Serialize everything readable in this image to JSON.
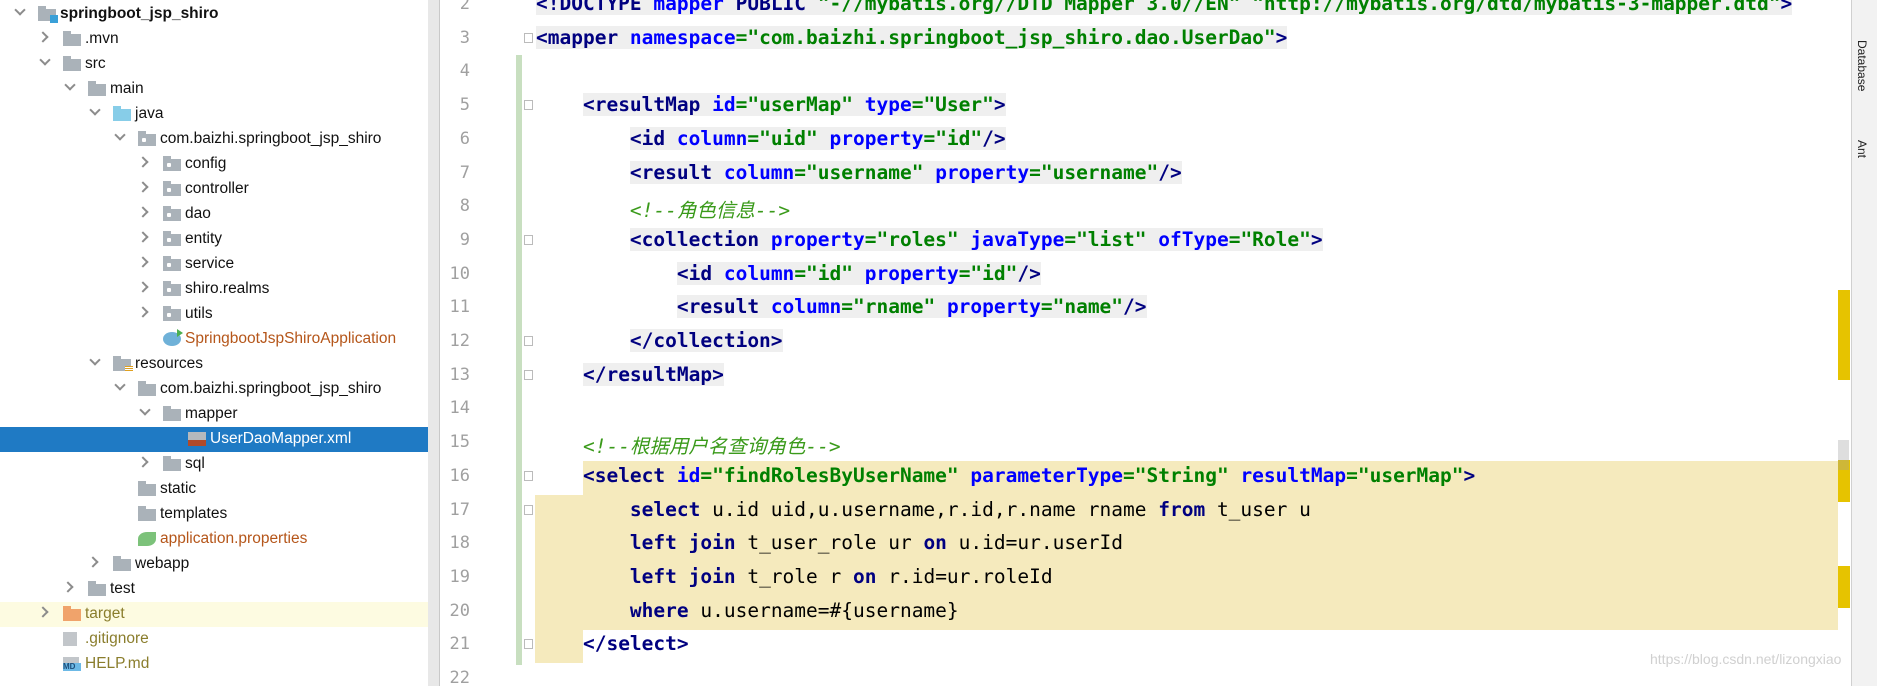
{
  "project_tree": {
    "selected": "UserDaoMapper.xml",
    "items": [
      {
        "label": "springboot_jsp_shiro",
        "level": 0,
        "arrow": "down",
        "icon": "mod",
        "bold": true
      },
      {
        "label": ".mvn",
        "level": 1,
        "arrow": "right",
        "icon": "folder"
      },
      {
        "label": "src",
        "level": 1,
        "arrow": "down",
        "icon": "folder"
      },
      {
        "label": "main",
        "level": 2,
        "arrow": "down",
        "icon": "folder"
      },
      {
        "label": "java",
        "level": 3,
        "arrow": "down",
        "icon": "src"
      },
      {
        "label": "com.baizhi.springboot_jsp_shiro",
        "level": 4,
        "arrow": "down",
        "icon": "pkg"
      },
      {
        "label": "config",
        "level": 5,
        "arrow": "right",
        "icon": "pkg"
      },
      {
        "label": "controller",
        "level": 5,
        "arrow": "right",
        "icon": "pkg"
      },
      {
        "label": "dao",
        "level": 5,
        "arrow": "right",
        "icon": "pkg"
      },
      {
        "label": "entity",
        "level": 5,
        "arrow": "right",
        "icon": "pkg"
      },
      {
        "label": "service",
        "level": 5,
        "arrow": "right",
        "icon": "pkg"
      },
      {
        "label": "shiro.realms",
        "level": 5,
        "arrow": "right",
        "icon": "pkg"
      },
      {
        "label": "utils",
        "level": 5,
        "arrow": "right",
        "icon": "pkg"
      },
      {
        "label": "SpringbootJspShiroApplication",
        "level": 5,
        "arrow": "",
        "icon": "spring",
        "color": "#b5561a"
      },
      {
        "label": "resources",
        "level": 3,
        "arrow": "down",
        "icon": "res"
      },
      {
        "label": "com.baizhi.springboot_jsp_shiro",
        "level": 4,
        "arrow": "down",
        "icon": "folder"
      },
      {
        "label": "mapper",
        "level": 5,
        "arrow": "down",
        "icon": "folder"
      },
      {
        "label": "UserDaoMapper.xml",
        "level": 6,
        "arrow": "",
        "icon": "xml",
        "selected": true
      },
      {
        "label": "sql",
        "level": 5,
        "arrow": "right",
        "icon": "folder"
      },
      {
        "label": "static",
        "level": 4,
        "arrow": "",
        "icon": "folder"
      },
      {
        "label": "templates",
        "level": 4,
        "arrow": "",
        "icon": "folder"
      },
      {
        "label": "application.properties",
        "level": 4,
        "arrow": "",
        "icon": "props",
        "color": "#b5561a"
      },
      {
        "label": "webapp",
        "level": 3,
        "arrow": "right",
        "icon": "folder"
      },
      {
        "label": "test",
        "level": 2,
        "arrow": "right",
        "icon": "folder"
      },
      {
        "label": "target",
        "level": 1,
        "arrow": "right",
        "icon": "excl",
        "color": "#8a7d2c",
        "highlight": true
      },
      {
        "label": ".gitignore",
        "level": 1,
        "arrow": "",
        "icon": "file",
        "color": "#8a7d2c"
      },
      {
        "label": "HELP.md",
        "level": 1,
        "arrow": "",
        "icon": "md",
        "color": "#8a7d2c"
      }
    ]
  },
  "editor": {
    "lines": [
      {
        "n": "2",
        "indent": "",
        "tokens": [
          {
            "t": "<!DOCTYPE ",
            "c": "tag"
          },
          {
            "t": "mapper ",
            "c": "attr"
          },
          {
            "t": "PUBLIC ",
            "c": "tag"
          },
          {
            "t": "\"-//mybatis.org//DTD Mapper 3.0//EN\" ",
            "c": "val"
          },
          {
            "t": "\"http://mybatis.org/dtd/mybatis-3-mapper.dtd\"",
            "c": "val"
          },
          {
            "t": ">",
            "c": "tag"
          }
        ],
        "bg": true
      },
      {
        "n": "3",
        "indent": "",
        "tokens": [
          {
            "t": "<mapper ",
            "c": "tag"
          },
          {
            "t": "namespace",
            "c": "attr"
          },
          {
            "t": "=\"com.baizhi.springboot_jsp_shiro.dao.UserDao\"",
            "c": "val"
          },
          {
            "t": ">",
            "c": "tag"
          }
        ],
        "bg": true,
        "fold": true
      },
      {
        "n": "4",
        "indent": "",
        "tokens": []
      },
      {
        "n": "5",
        "indent": "    ",
        "tokens": [
          {
            "t": "<resultMap ",
            "c": "tag"
          },
          {
            "t": "id",
            "c": "attr"
          },
          {
            "t": "=\"userMap\" ",
            "c": "val"
          },
          {
            "t": "type",
            "c": "attr"
          },
          {
            "t": "=\"User\"",
            "c": "val"
          },
          {
            "t": ">",
            "c": "tag"
          }
        ],
        "bg": true,
        "fold": true
      },
      {
        "n": "6",
        "indent": "        ",
        "tokens": [
          {
            "t": "<id ",
            "c": "tag"
          },
          {
            "t": "column",
            "c": "attr"
          },
          {
            "t": "=\"uid\" ",
            "c": "val"
          },
          {
            "t": "property",
            "c": "attr"
          },
          {
            "t": "=\"id\"",
            "c": "val"
          },
          {
            "t": "/>",
            "c": "tag"
          }
        ],
        "bg": true
      },
      {
        "n": "7",
        "indent": "        ",
        "tokens": [
          {
            "t": "<result ",
            "c": "tag"
          },
          {
            "t": "column",
            "c": "attr"
          },
          {
            "t": "=\"username\" ",
            "c": "val"
          },
          {
            "t": "property",
            "c": "attr"
          },
          {
            "t": "=\"username\"",
            "c": "val"
          },
          {
            "t": "/>",
            "c": "tag"
          }
        ],
        "bg": true
      },
      {
        "n": "8",
        "indent": "        ",
        "tokens": [
          {
            "t": "<!--角色信息-->",
            "c": "cmt"
          }
        ]
      },
      {
        "n": "9",
        "indent": "        ",
        "tokens": [
          {
            "t": "<collection ",
            "c": "tag"
          },
          {
            "t": "property",
            "c": "attr"
          },
          {
            "t": "=\"roles\" ",
            "c": "val"
          },
          {
            "t": "javaType",
            "c": "attr"
          },
          {
            "t": "=\"list\" ",
            "c": "val"
          },
          {
            "t": "ofType",
            "c": "attr"
          },
          {
            "t": "=\"Role\"",
            "c": "val"
          },
          {
            "t": ">",
            "c": "tag"
          }
        ],
        "bg": true,
        "fold": true
      },
      {
        "n": "10",
        "indent": "            ",
        "tokens": [
          {
            "t": "<id ",
            "c": "tag"
          },
          {
            "t": "column",
            "c": "attr"
          },
          {
            "t": "=\"id\" ",
            "c": "val"
          },
          {
            "t": "property",
            "c": "attr"
          },
          {
            "t": "=\"id\"",
            "c": "val"
          },
          {
            "t": "/>",
            "c": "tag"
          }
        ],
        "bg": true
      },
      {
        "n": "11",
        "indent": "            ",
        "tokens": [
          {
            "t": "<result ",
            "c": "tag"
          },
          {
            "t": "column",
            "c": "attr"
          },
          {
            "t": "=\"rname\" ",
            "c": "val"
          },
          {
            "t": "property",
            "c": "attr"
          },
          {
            "t": "=\"name\"",
            "c": "val"
          },
          {
            "t": "/>",
            "c": "tag"
          }
        ],
        "bg": true
      },
      {
        "n": "12",
        "indent": "        ",
        "tokens": [
          {
            "t": "</collection>",
            "c": "tag"
          }
        ],
        "bg": true,
        "fold": true
      },
      {
        "n": "13",
        "indent": "    ",
        "tokens": [
          {
            "t": "</resultMap>",
            "c": "tag"
          }
        ],
        "bg": true,
        "fold": true
      },
      {
        "n": "14",
        "indent": "",
        "tokens": []
      },
      {
        "n": "15",
        "indent": "    ",
        "tokens": [
          {
            "t": "<!--根据用户名查询角色-->",
            "c": "cmt"
          }
        ]
      },
      {
        "n": "16",
        "indent": "    ",
        "tokens": [
          {
            "t": "<select ",
            "c": "tag"
          },
          {
            "t": "id",
            "c": "attr"
          },
          {
            "t": "=\"findRolesByUserName\" ",
            "c": "val"
          },
          {
            "t": "parameterType",
            "c": "attr"
          },
          {
            "t": "=\"String\" ",
            "c": "val"
          },
          {
            "t": "resultMap",
            "c": "attr"
          },
          {
            "t": "=\"userMap\"",
            "c": "val"
          },
          {
            "t": ">",
            "c": "tag"
          }
        ],
        "fold": true
      },
      {
        "n": "17",
        "indent": "        ",
        "tokens": [
          {
            "t": "select ",
            "c": "kw"
          },
          {
            "t": "u.id uid,u.username,r.id,r.name rname ",
            "c": "txt"
          },
          {
            "t": "from ",
            "c": "kw"
          },
          {
            "t": "t_user u",
            "c": "txt"
          }
        ],
        "fold": true
      },
      {
        "n": "18",
        "indent": "        ",
        "tokens": [
          {
            "t": "left join ",
            "c": "kw"
          },
          {
            "t": "t_user_role ur ",
            "c": "txt"
          },
          {
            "t": "on ",
            "c": "kw"
          },
          {
            "t": "u.id=ur.userId",
            "c": "txt"
          }
        ]
      },
      {
        "n": "19",
        "indent": "        ",
        "tokens": [
          {
            "t": "left join ",
            "c": "kw"
          },
          {
            "t": "t_role r ",
            "c": "txt"
          },
          {
            "t": "on ",
            "c": "kw"
          },
          {
            "t": "r.id=ur.roleId",
            "c": "txt"
          }
        ]
      },
      {
        "n": "20",
        "indent": "        ",
        "tokens": [
          {
            "t": "where ",
            "c": "kw"
          },
          {
            "t": "u.username=#{username}",
            "c": "txt"
          }
        ]
      },
      {
        "n": "21",
        "indent": "    ",
        "tokens": [
          {
            "t": "</select>",
            "c": "tag"
          }
        ],
        "fold": true
      },
      {
        "n": "22",
        "indent": "",
        "tokens": []
      }
    ]
  },
  "tool_windows": {
    "database": "Database",
    "ant": "Ant"
  },
  "colors": {
    "selection": "#1f7ac4",
    "highlight": "#f5eabd",
    "marker": "#e6c300"
  },
  "watermark": "https://blog.csdn.net/lizongxiao"
}
